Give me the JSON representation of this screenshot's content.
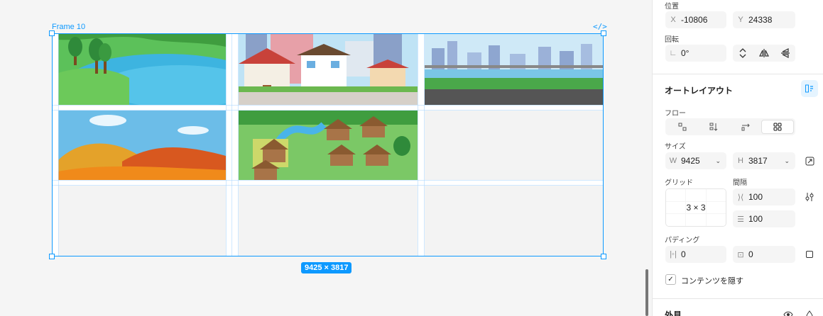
{
  "canvas": {
    "frame_name": "Frame 10",
    "code_icon": "</>",
    "dimension_badge": "9425 × 3817",
    "grid": {
      "rows": 3,
      "cols": 3,
      "cells": [
        "pond",
        "houses",
        "river",
        "autumn-hills",
        "village",
        "empty",
        "empty",
        "empty",
        "empty"
      ]
    }
  },
  "panel": {
    "position": {
      "title": "位置",
      "x_prefix": "X",
      "x_value": "-10806",
      "y_prefix": "Y",
      "y_value": "24338"
    },
    "rotation": {
      "title": "回転",
      "prefix": "∟",
      "value": "0°"
    },
    "auto_layout": {
      "title": "オートレイアウト",
      "flow_label": "フロー",
      "flow_options": [
        "free",
        "vertical",
        "horizontal",
        "grid"
      ],
      "flow_selected": "grid",
      "size_label": "サイズ",
      "w_prefix": "W",
      "w_value": "9425",
      "h_prefix": "H",
      "h_value": "3817",
      "grid_label": "グリッド",
      "grid_value": "3 × 3",
      "gap_label": "間隔",
      "gap_col_value": "100",
      "gap_row_value": "100",
      "padding_label": "パディング",
      "padding_h_value": "0",
      "padding_v_value": "0",
      "clip_label": "コンテンツを隠す",
      "clip_checked": true
    },
    "appearance": {
      "title": "外見"
    }
  },
  "colors": {
    "accent": "#0d99ff",
    "canvas_bg": "#f5f5f5",
    "panel_bg": "#ffffff"
  }
}
